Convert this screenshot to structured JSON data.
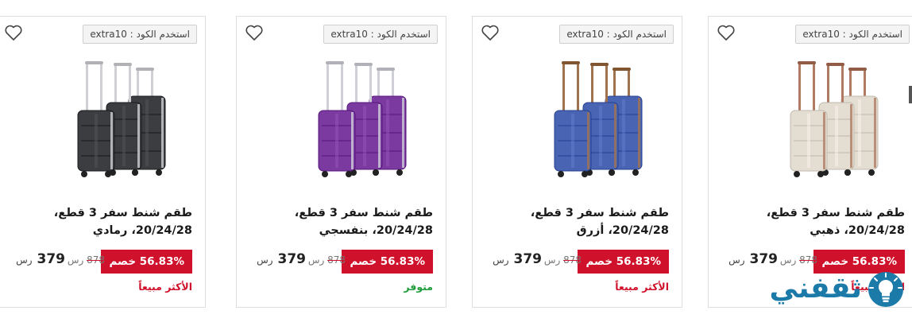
{
  "products": [
    {
      "coupon": "استخدم الكود : extra10",
      "title": "طقم شنط سفر 3 قطع، 20/24/28، ذهبي",
      "discount": "56.83% خصم",
      "old_price": "878",
      "old_currency": "رس",
      "price": "379",
      "currency": "رس",
      "status": "الأكثر مبيعاً",
      "status_type": "best",
      "color": "#e4ddd2",
      "accent": "#b07a62"
    },
    {
      "coupon": "استخدم الكود : extra10",
      "title": "طقم شنط سفر 3 قطع، 20/24/28، أزرق",
      "discount": "56.83% خصم",
      "old_price": "878",
      "old_currency": "رس",
      "price": "379",
      "currency": "رس",
      "status": "الأكثر مبيعاً",
      "status_type": "best",
      "color": "#4a64b4",
      "accent": "#a0734f"
    },
    {
      "coupon": "استخدم الكود : extra10",
      "title": "طقم شنط سفر 3 قطع، 20/24/28، بنفسجي",
      "discount": "56.83% خصم",
      "old_price": "878",
      "old_currency": "رس",
      "price": "379",
      "currency": "رس",
      "status": "متوفر",
      "status_type": "avail",
      "color": "#7a3aa0",
      "accent": "#cfcfd8"
    },
    {
      "coupon": "استخدم الكود : extra10",
      "title": "طقم شنط سفر 3 قطع، 20/24/28، رمادي",
      "discount": "56.83% خصم",
      "old_price": "878",
      "old_currency": "رس",
      "price": "379",
      "currency": "رس",
      "status": "الأكثر مبيعاً",
      "status_type": "best",
      "color": "#3c3d40",
      "accent": "#cfcfd4"
    }
  ],
  "watermark": {
    "text": "ثقفني"
  }
}
